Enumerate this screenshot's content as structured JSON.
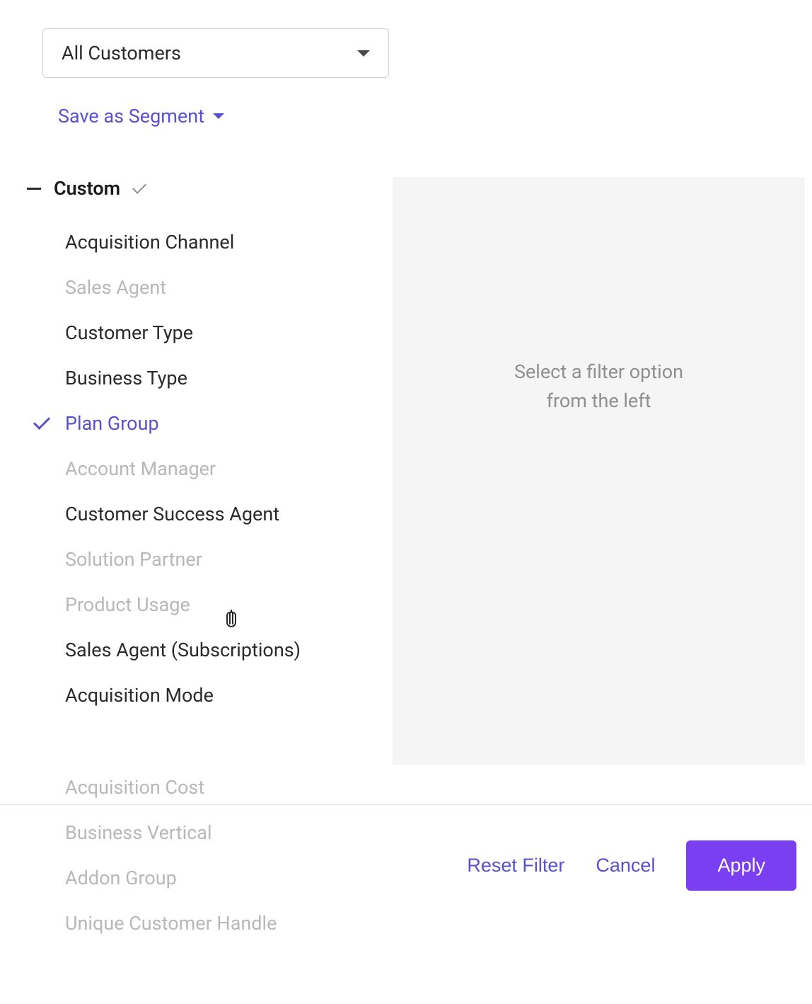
{
  "dropdown": {
    "selected_label": "All Customers"
  },
  "save_segment_label": "Save as Segment",
  "section": {
    "title": "Custom"
  },
  "filters": [
    {
      "label": "Acquisition Channel",
      "state": "normal"
    },
    {
      "label": "Sales Agent",
      "state": "disabled"
    },
    {
      "label": "Customer Type",
      "state": "normal"
    },
    {
      "label": "Business Type",
      "state": "normal"
    },
    {
      "label": "Plan Group",
      "state": "selected"
    },
    {
      "label": "Account Manager",
      "state": "disabled"
    },
    {
      "label": "Customer Success Agent",
      "state": "normal"
    },
    {
      "label": "Solution Partner",
      "state": "disabled"
    },
    {
      "label": "Product Usage",
      "state": "disabled"
    },
    {
      "label": "Sales Agent (Subscriptions)",
      "state": "normal"
    },
    {
      "label": "Acquisition Mode",
      "state": "normal"
    },
    {
      "label": "Acquisition Cost",
      "state": "disabled"
    },
    {
      "label": "Business Vertical",
      "state": "disabled"
    },
    {
      "label": "Addon Group",
      "state": "disabled"
    },
    {
      "label": "Unique Customer Handle",
      "state": "disabled"
    }
  ],
  "right_panel_hint": "Select a filter option from the left",
  "footer": {
    "reset_label": "Reset Filter",
    "cancel_label": "Cancel",
    "apply_label": "Apply"
  }
}
